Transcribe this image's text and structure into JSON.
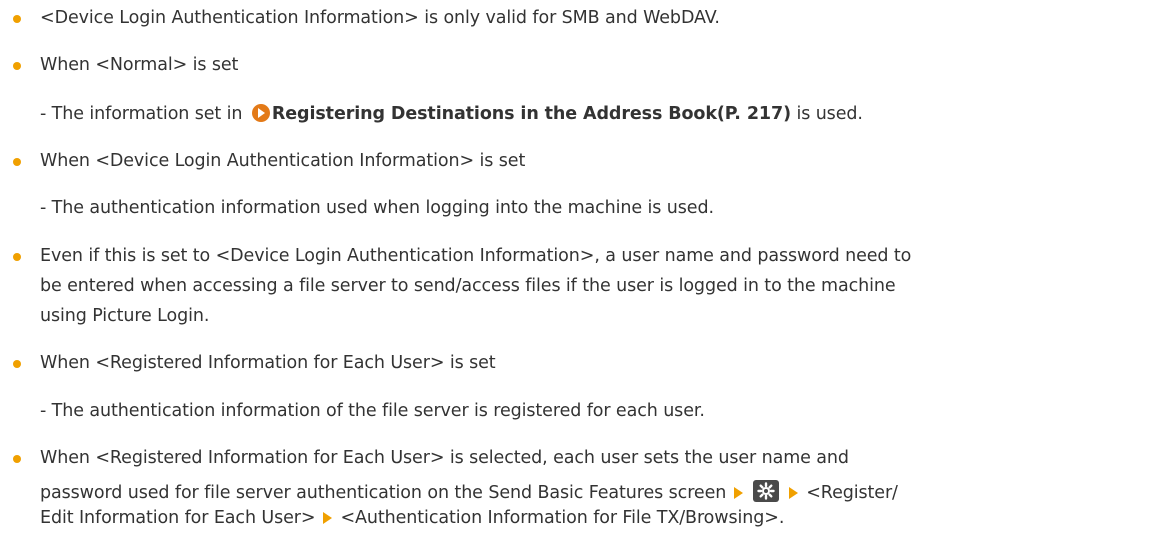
{
  "items": [
    {
      "text": "<Device Login Authentication Information> is only valid for SMB and WebDAV."
    },
    {
      "text": "When <Normal> is set",
      "sub": {
        "before": "- The information set in ",
        "link": "Registering Destinations in the Address Book(P. 217)",
        "after": " is used."
      }
    },
    {
      "text": "When <Device Login Authentication Information> is set",
      "sub": {
        "text": "- The authentication information used when logging into the machine is used."
      }
    },
    {
      "lines": [
        "Even if this is set to <Device Login Authentication Information>, a user name and password need to",
        "be entered when accessing a file server to send/access files if the user is logged in to the machine",
        "using Picture Login."
      ]
    },
    {
      "text": "When <Registered Information for Each User> is set",
      "sub": {
        "text": "- The authentication information of the file server is registered for each user."
      }
    },
    {
      "line1": "When <Registered Information for Each User> is selected, each user sets the user name and",
      "line2": "password used for file server authentication on the Send Basic Features screen",
      "line2_after": "<Register/",
      "line3_before": "Edit Information for Each User>",
      "line3_after": "<Authentication Information for File TX/Browsing>."
    }
  ],
  "icons": {
    "bullet": "orange-dot",
    "link": "orange-circle-arrow-icon",
    "step": "orange-triangle-icon",
    "settings": "settings-gear-key-icon"
  },
  "colors": {
    "accent": "#f0a000",
    "link_icon": "#e37a18",
    "text": "#333333"
  }
}
